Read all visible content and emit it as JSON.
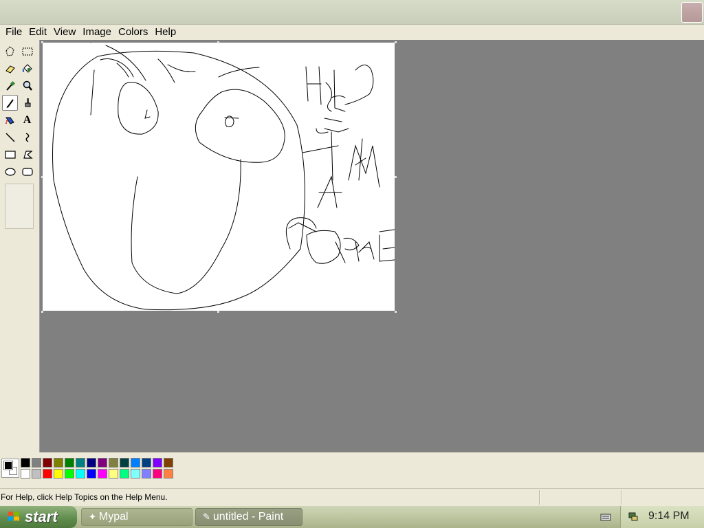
{
  "menu": {
    "items": [
      {
        "label": "File"
      },
      {
        "label": "Edit"
      },
      {
        "label": "View"
      },
      {
        "label": "Image"
      },
      {
        "label": "Colors"
      },
      {
        "label": "Help"
      }
    ]
  },
  "toolbox": {
    "tools": [
      {
        "name": "free-form-select-tool-icon"
      },
      {
        "name": "rectangle-select-tool-icon"
      },
      {
        "name": "eraser-tool-icon"
      },
      {
        "name": "fill-bucket-tool-icon"
      },
      {
        "name": "color-picker-tool-icon"
      },
      {
        "name": "magnifier-tool-icon"
      },
      {
        "name": "pencil-tool-icon",
        "selected": true
      },
      {
        "name": "brush-tool-icon"
      },
      {
        "name": "airbrush-tool-icon"
      },
      {
        "name": "text-tool-icon",
        "glyph": "A"
      },
      {
        "name": "line-tool-icon"
      },
      {
        "name": "curve-tool-icon"
      },
      {
        "name": "rectangle-tool-icon"
      },
      {
        "name": "polygon-tool-icon"
      },
      {
        "name": "ellipse-tool-icon"
      },
      {
        "name": "rounded-rectangle-tool-icon"
      }
    ]
  },
  "colors": {
    "foreground": "#000000",
    "background": "#ffffff",
    "palette_top": [
      "#000000",
      "#808080",
      "#800000",
      "#808000",
      "#008000",
      "#008080",
      "#000080",
      "#800080",
      "#808040",
      "#004040",
      "#0080ff",
      "#004080",
      "#8000ff",
      "#804000"
    ],
    "palette_bottom": [
      "#ffffff",
      "#c0c0c0",
      "#ff0000",
      "#ffff00",
      "#00ff00",
      "#00ffff",
      "#0000ff",
      "#ff00ff",
      "#ffff80",
      "#00ff80",
      "#80ffff",
      "#8080ff",
      "#ff0080",
      "#ff8040"
    ]
  },
  "status": {
    "text": "For Help, click Help Topics on the Help Menu."
  },
  "taskbar": {
    "start_label": "start",
    "tasks": [
      {
        "label": "Mypal"
      },
      {
        "label": "untitled - Paint"
      }
    ],
    "clock": "9:14 PM"
  }
}
